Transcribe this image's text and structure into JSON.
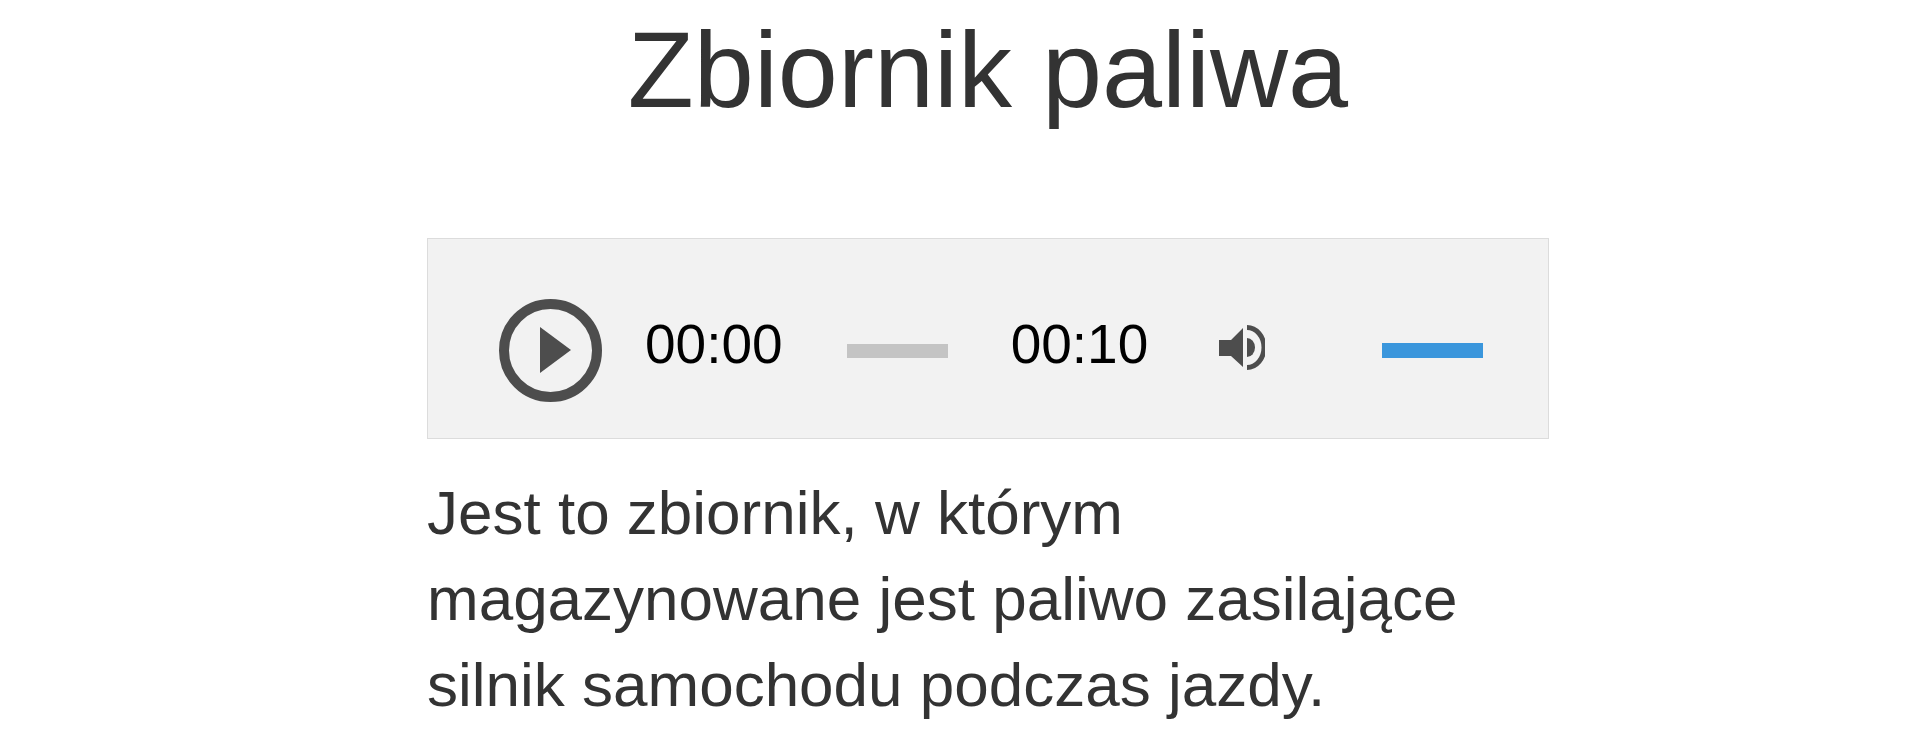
{
  "title": "Zbiornik paliwa",
  "audio_player": {
    "playing": false,
    "current_time": "00:00",
    "progress": {
      "level": 0
    },
    "duration": "00:10",
    "muted": false,
    "volume": {
      "level": 1
    }
  },
  "description": "Jest to zbiornik, w którym magazynowane jest paliwo zasilające silnik samochodu podczas jazdy."
}
